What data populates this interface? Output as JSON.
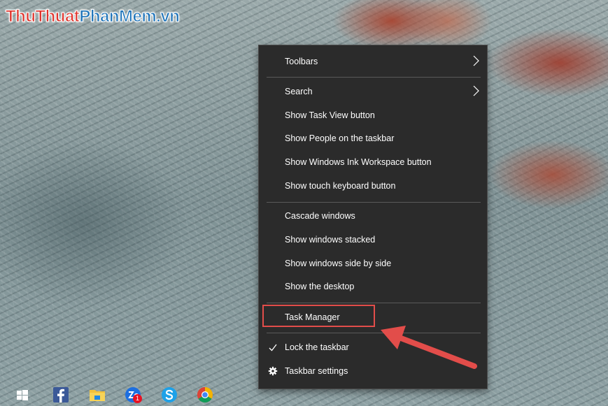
{
  "watermark": {
    "part1": "ThuThuat",
    "part2": "PhanMem",
    "part3": ".vn"
  },
  "context_menu": {
    "items": [
      {
        "label": "Toolbars",
        "submenu": true
      },
      {
        "label": "Search",
        "submenu": true
      },
      {
        "label": "Show Task View button"
      },
      {
        "label": "Show People on the taskbar"
      },
      {
        "label": "Show Windows Ink Workspace button"
      },
      {
        "label": "Show touch keyboard button"
      },
      {
        "label": "Cascade windows"
      },
      {
        "label": "Show windows stacked"
      },
      {
        "label": "Show windows side by side"
      },
      {
        "label": "Show the desktop"
      },
      {
        "label": "Task Manager",
        "highlighted": true
      },
      {
        "label": "Lock the taskbar",
        "checked": true
      },
      {
        "label": "Taskbar settings",
        "icon": "gear-icon"
      }
    ]
  },
  "taskbar": {
    "icons": [
      "windows-start-icon",
      "facebook-icon",
      "file-explorer-icon",
      "zalo-icon",
      "skype-icon",
      "chrome-icon"
    ],
    "zalo_badge": "1"
  },
  "colors": {
    "menu_bg": "#2b2b2b",
    "highlight": "#e24d4a",
    "watermark_red": "#e0342c",
    "watermark_blue": "#1d73b9"
  }
}
